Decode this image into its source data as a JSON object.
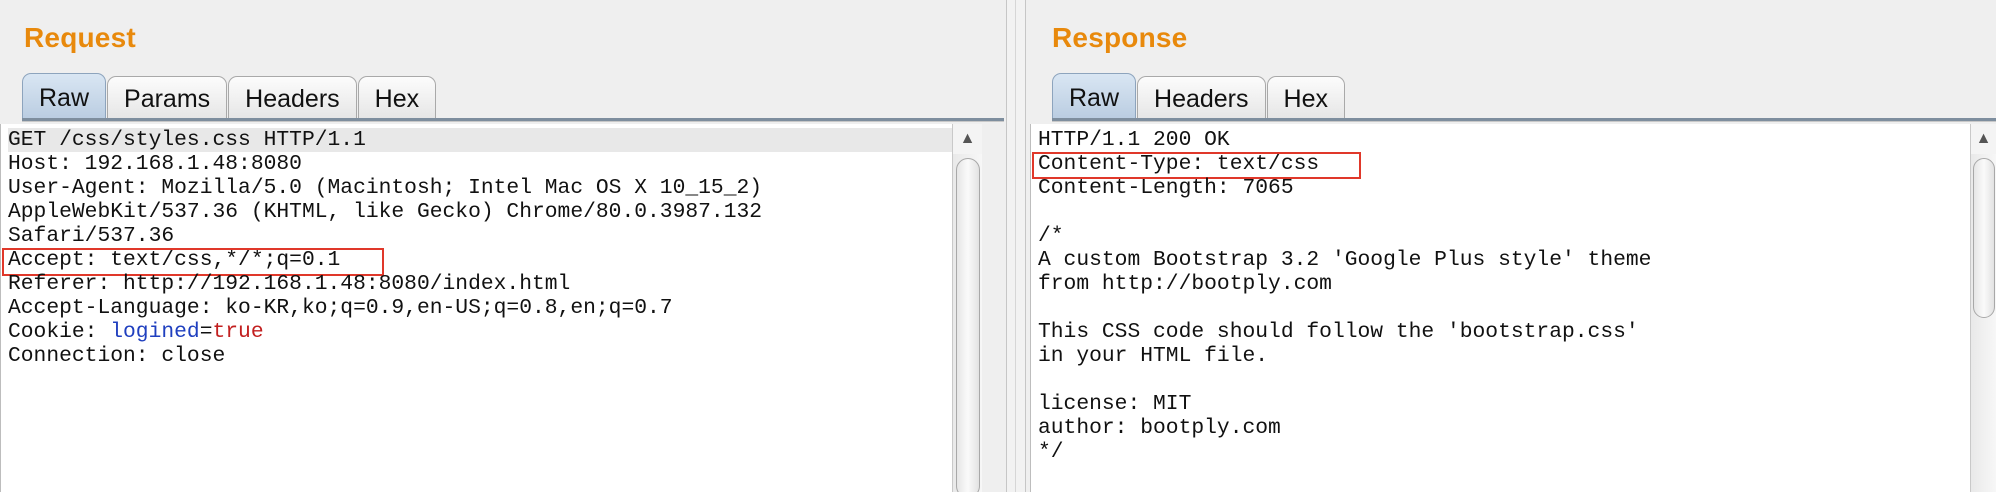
{
  "request": {
    "title": "Request",
    "tabs": [
      "Raw",
      "Params",
      "Headers",
      "Hex"
    ],
    "active_tab": "Raw",
    "lines": [
      "GET /css/styles.css HTTP/1.1",
      "Host: 192.168.1.48:8080",
      "User-Agent: Mozilla/5.0 (Macintosh; Intel Mac OS X 10_15_2)",
      "AppleWebKit/537.36 (KHTML, like Gecko) Chrome/80.0.3987.132",
      "Safari/537.36",
      "Accept: text/css,*/*;q=0.1",
      "Referer: http://192.168.1.48:8080/index.html",
      "Accept-Language: ko-KR,ko;q=0.9,en-US;q=0.8,en;q=0.7"
    ],
    "cookie": {
      "prefix": "Cookie: ",
      "name": "logined",
      "eq": "=",
      "value": "true"
    },
    "last_line": "Connection: close"
  },
  "response": {
    "title": "Response",
    "tabs": [
      "Raw",
      "Headers",
      "Hex"
    ],
    "active_tab": "Raw",
    "lines": [
      "HTTP/1.1 200 OK",
      "Content-Type: text/css",
      "Content-Length: 7065",
      "",
      "/*",
      "A custom Bootstrap 3.2 'Google Plus style' theme",
      "from http://bootply.com",
      "",
      "This CSS code should follow the 'bootstrap.css'",
      "in your HTML file.",
      "",
      "license: MIT",
      "author: bootply.com",
      "*/"
    ]
  },
  "icons": {
    "scroll_up": "scroll-up-arrow-icon"
  },
  "colors": {
    "title": "#e8890c",
    "highlight_box": "#e0382a",
    "cookie_name": "#1f3fbf",
    "cookie_value": "#c21f1f"
  }
}
